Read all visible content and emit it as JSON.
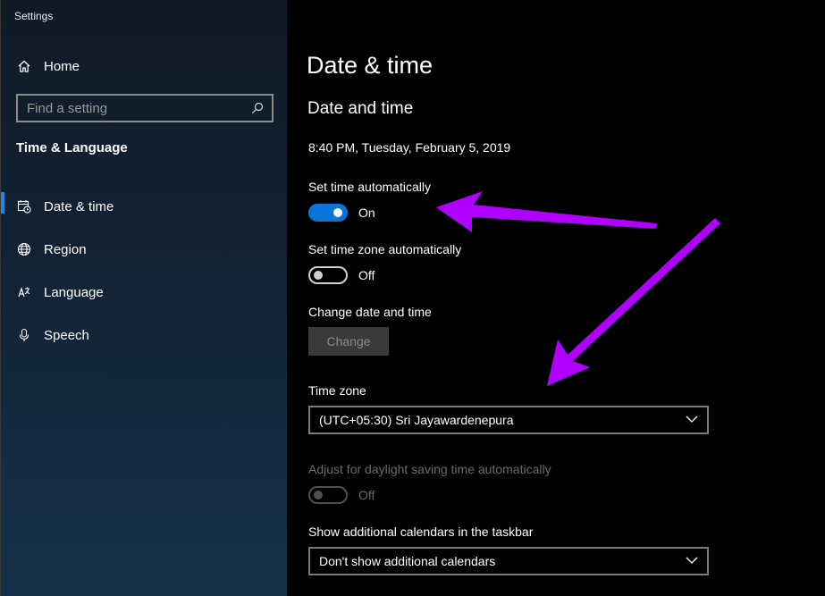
{
  "window": {
    "title": "Settings"
  },
  "sidebar": {
    "home_label": "Home",
    "search_placeholder": "Find a setting",
    "section_title": "Time & Language",
    "items": [
      {
        "label": "Date & time",
        "icon": "calendar-clock-icon",
        "active": true
      },
      {
        "label": "Region",
        "icon": "globe-icon",
        "active": false
      },
      {
        "label": "Language",
        "icon": "language-icon",
        "active": false
      },
      {
        "label": "Speech",
        "icon": "microphone-icon",
        "active": false
      }
    ]
  },
  "main": {
    "title": "Date & time",
    "subhead": "Date and time",
    "current_time": "8:40 PM, Tuesday, February 5, 2019",
    "set_time_auto": {
      "label": "Set time automatically",
      "state": "On"
    },
    "set_tz_auto": {
      "label": "Set time zone automatically",
      "state": "Off"
    },
    "change_date": {
      "label": "Change date and time",
      "button": "Change"
    },
    "time_zone": {
      "label": "Time zone",
      "value": "(UTC+05:30) Sri Jayawardenepura"
    },
    "dst": {
      "label": "Adjust for daylight saving time automatically",
      "state": "Off"
    },
    "calendars": {
      "label": "Show additional calendars in the taskbar",
      "value": "Don't show additional calendars"
    }
  },
  "colors": {
    "accent": "#0a74da",
    "annotation_arrow": "#b000ff"
  }
}
